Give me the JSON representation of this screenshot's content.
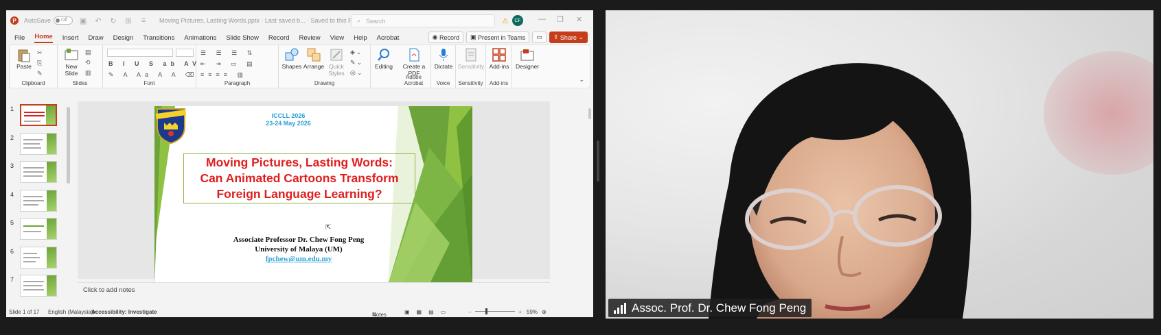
{
  "app": {
    "autosave_label": "AutoSave",
    "autosave_state": "Off",
    "document_title": "Moving Pictures, Lasting Words.pptx  ·  Last saved b...  ·  Saved to this PC ⌄",
    "search_placeholder": "Search",
    "user_initials": "CF"
  },
  "menu": {
    "items": [
      "File",
      "Home",
      "Insert",
      "Draw",
      "Design",
      "Transitions",
      "Animations",
      "Slide Show",
      "Record",
      "Review",
      "View",
      "Help",
      "Acrobat"
    ],
    "active": "Home",
    "record_button": "Record",
    "present_button": "Present in Teams",
    "share_button": "Share"
  },
  "ribbon": {
    "paste": "Paste",
    "new_slide": "New Slide",
    "shapes": "Shapes",
    "arrange": "Arrange",
    "quick_styles": "Quick Styles",
    "editing": "Editing",
    "create_pdf": "Create a PDF",
    "dictate": "Dictate",
    "sensitivity": "Sensitivity",
    "addins": "Add-ins",
    "designer": "Designer",
    "groups": {
      "clipboard": "Clipboard",
      "slides": "Slides",
      "font": "Font",
      "paragraph": "Paragraph",
      "drawing": "Drawing",
      "adobe": "Adobe Acrobat",
      "voice": "Voice",
      "sensitivity": "Sensitivity",
      "addins": "Add-ins"
    }
  },
  "thumbnails": [
    "1",
    "2",
    "3",
    "4",
    "5",
    "6",
    "7"
  ],
  "slide": {
    "conference": "ICCLL 2026",
    "dates": "23-24 May 2026",
    "title_line1": "Moving Pictures, Lasting Words:",
    "title_line2": "Can Animated Cartoons Transform",
    "title_line3": "Foreign Language Learning?",
    "author": "Associate Professor Dr. Chew Fong Peng",
    "affiliation": "University of Malaya (UM)",
    "email": "fpchew@um.edu.my"
  },
  "notes_placeholder": "Click to add notes",
  "status": {
    "slide_counter": "Slide 1 of 17",
    "language": "English (Malaysia)",
    "accessibility": "Accessibility: Investigate",
    "notes": "Notes",
    "zoom": "59%"
  },
  "video": {
    "participant_name": "Assoc. Prof. Dr. Chew Fong Peng"
  },
  "colors": {
    "accent": "#c43e1c",
    "title_red": "#e01e1e",
    "link_blue": "#2b9fd6",
    "green": "#6ca33a"
  }
}
